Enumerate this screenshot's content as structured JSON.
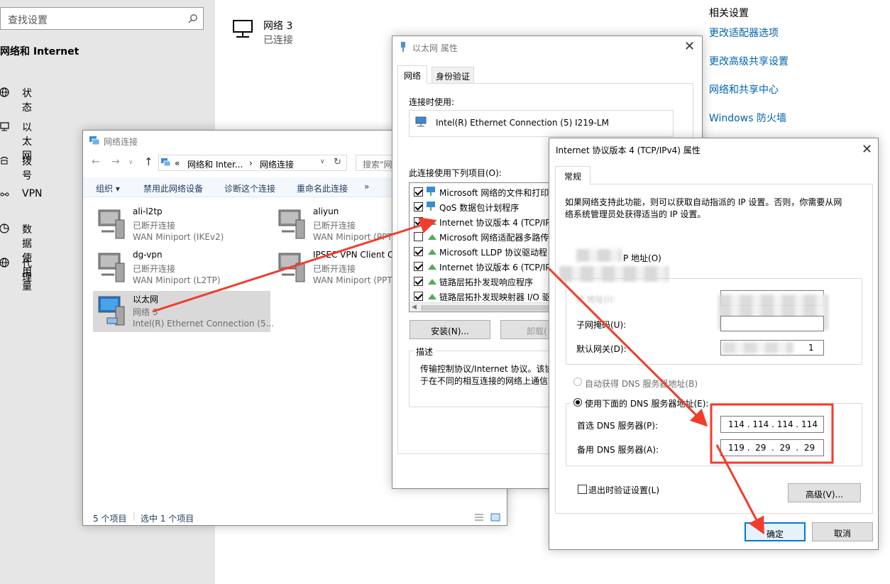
{
  "settings": {
    "search_placeholder": "查找设置",
    "section_title": "网络和 Internet",
    "nav": [
      {
        "label": "状态",
        "icon": "globe-icon"
      },
      {
        "label": "以太网",
        "icon": "ethernet-icon"
      },
      {
        "label": "拨号",
        "icon": "dialup-icon"
      },
      {
        "label": "VPN",
        "icon": "vpn-icon"
      },
      {
        "label": "数据使用量",
        "icon": "data-usage-icon"
      },
      {
        "label": "代理",
        "icon": "globe-icon"
      }
    ],
    "network_name": "网络 3",
    "network_status": "已连接",
    "related_title": "相关设置",
    "related_links": [
      "更改适配器选项",
      "更改高级共享设置",
      "网络和共享中心",
      "Windows 防火墙"
    ]
  },
  "netconn": {
    "title": "网络连接",
    "breadcrumb": [
      "«",
      "网络和 Inter...",
      "›",
      "网络连接"
    ],
    "search_placeholder": "搜索\"网",
    "toolbar": [
      "组织 ▾",
      "禁用此网络设备",
      "诊断这个连接",
      "重命名此连接",
      "»"
    ],
    "items": [
      {
        "name": "ali-l2tp",
        "status": "已断开连接",
        "device": "WAN Miniport (IKEv2)"
      },
      {
        "name": "aliyun",
        "status": "已断开连接",
        "device": "WAN Miniport (PPT"
      },
      {
        "name": "dg-vpn",
        "status": "已断开连接",
        "device": "WAN Miniport (L2TP)"
      },
      {
        "name": "IPSEC VPN Client C",
        "status": "已断开连接",
        "device": "WAN Miniport (PPT"
      },
      {
        "name": "以太网",
        "status": "网络 3",
        "device": "Intel(R) Ethernet Connection (5..."
      }
    ],
    "status_count": "5 个项目",
    "status_selected": "选中 1 个项目"
  },
  "ethprops": {
    "title": "以太网 属性",
    "tabs": [
      "网络",
      "身份验证"
    ],
    "connect_using_label": "连接时使用:",
    "adapter": "Intel(R) Ethernet Connection (5) I219-LM",
    "items_label": "此连接使用下列项目(O):",
    "items": [
      "Microsoft 网络的文件和打印",
      "QoS 数据包计划程序",
      "Internet 协议版本 4 (TCP/IP",
      "Microsoft 网络适配器多路传",
      "Microsoft LLDP 协议驱动程",
      "Internet 协议版本 6 (TCP/IP",
      "链路层拓扑发现响应程序",
      "链路层拓扑发现映射器 I/O 驱"
    ],
    "install_btn": "安装(N)...",
    "uninstall_btn": "卸载(",
    "desc_label": "描述",
    "desc_text_1": "传输控制协议/Internet 协议。该协",
    "desc_text_2": "于在不同的相互连接的网络上通信"
  },
  "ipv4": {
    "title": "Internet 协议版本 4 (TCP/IPv4) 属性",
    "tab": "常规",
    "intro_1": "如果网络支持此功能，则可以获取自动指派的 IP 设置。否则，你需要从网",
    "intro_2": "络系统管理员处获得适当的 IP 设置。",
    "use_ip_label": "P 地址(O)",
    "subnet_label": "子网掩码(U):",
    "gateway_label": "默认网关(D):",
    "gateway_tail": "1",
    "ip_label": "IP 地址(I):",
    "auto_dns": "自动获得 DNS 服务器地址(B)",
    "manual_dns": "使用下面的 DNS 服务器地址(E):",
    "pref_dns_label": "首选 DNS 服务器(P):",
    "pref_dns": "114 . 114 . 114 . 114",
    "alt_dns_label": "备用 DNS 服务器(A):",
    "alt_dns": "119 .  29  .  29  .  29",
    "validate_label": "退出时验证设置(L)",
    "advanced_btn": "高级(V)...",
    "ok_btn": "确定",
    "cancel_btn": "取消"
  },
  "colors": {
    "accent": "#0063b1",
    "annotation": "#f23c2c"
  }
}
